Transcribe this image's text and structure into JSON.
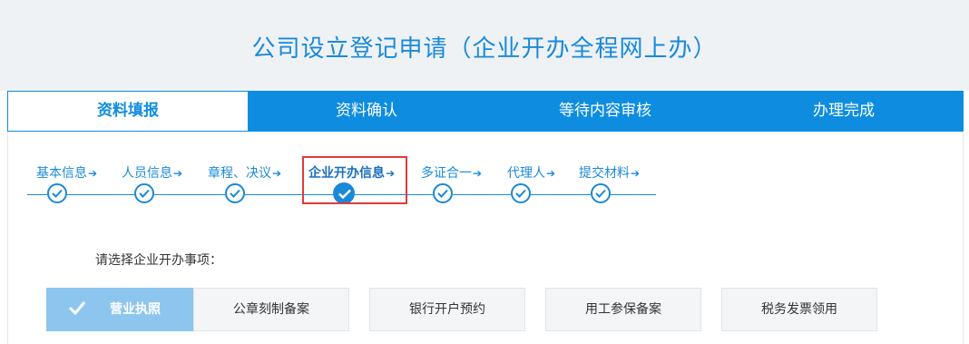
{
  "page": {
    "title": "公司设立登记申请（企业开办全程网上办）"
  },
  "tabs": [
    {
      "label": "资料填报",
      "active": true
    },
    {
      "label": "资料确认",
      "active": false
    },
    {
      "label": "等待内容审核",
      "active": false
    },
    {
      "label": "办理完成",
      "active": false
    }
  ],
  "steps": [
    {
      "label": "基本信息",
      "completed": true,
      "current": false
    },
    {
      "label": "人员信息",
      "completed": true,
      "current": false
    },
    {
      "label": "章程、决议",
      "completed": true,
      "current": false
    },
    {
      "label": "企业开办信息",
      "completed": true,
      "current": true
    },
    {
      "label": "多证合一",
      "completed": true,
      "current": false
    },
    {
      "label": "代理人",
      "completed": true,
      "current": false
    },
    {
      "label": "提交材料",
      "completed": true,
      "current": false
    }
  ],
  "step_arrow": "➔",
  "prompt": "请选择企业开办事项：",
  "options": [
    {
      "label": "营业执照",
      "selected": true
    },
    {
      "label": "公章刻制备案",
      "selected": false
    },
    {
      "label": "银行开户预约",
      "selected": false
    },
    {
      "label": "用工参保备案",
      "selected": false
    },
    {
      "label": "税务发票领用",
      "selected": false
    }
  ],
  "colors": {
    "accent": "#0e8de0",
    "step_blue": "#1a89d9",
    "highlight_red": "#e03b3b",
    "selected_option": "#8cc6ee"
  }
}
